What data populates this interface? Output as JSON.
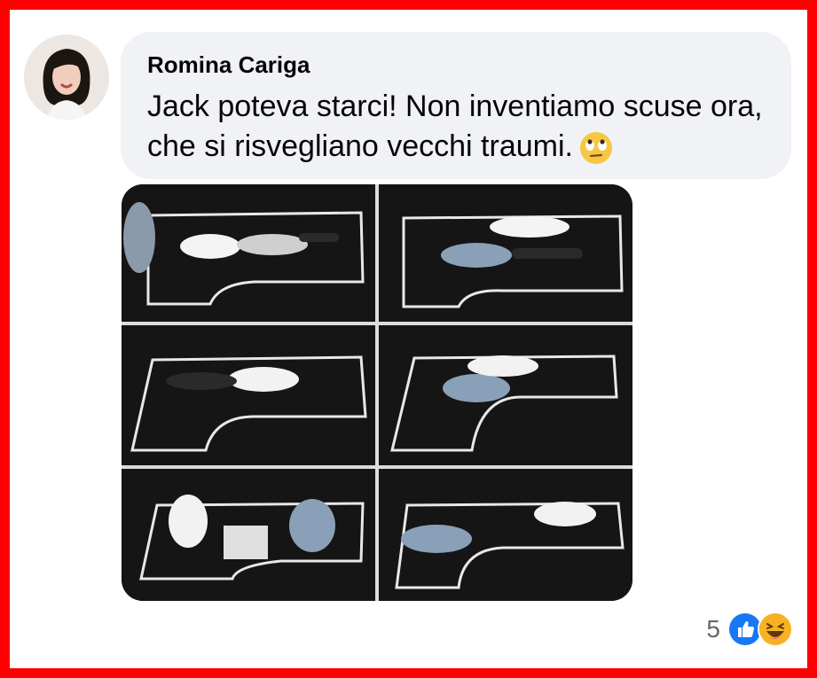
{
  "comment": {
    "author": "Romina Cariga",
    "text": "Jack poteva starci! Non inventiamo scuse ora, che si risvegliano vecchi traumi.",
    "inline_emoji": "face-with-rolling-eyes-icon"
  },
  "reactions": {
    "count": "5",
    "icons": [
      "like-reaction-icon",
      "haha-reaction-icon"
    ]
  },
  "colors": {
    "frame": "#ff0000",
    "bubble": "#f0f2f5",
    "like_blue": "#1877f2",
    "haha_yellow": "#f7b125"
  }
}
